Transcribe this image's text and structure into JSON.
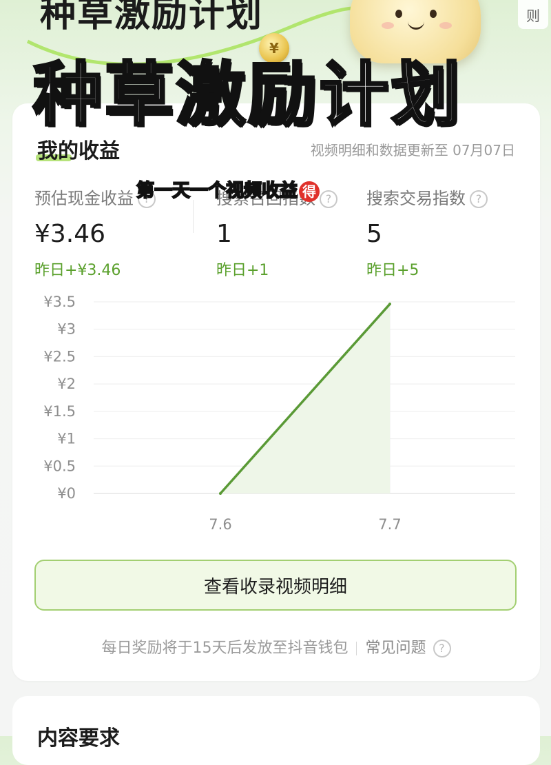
{
  "banner": {
    "title_top": "种草激励计划",
    "coin_symbol": "¥",
    "rules_tab": "则"
  },
  "overlay": {
    "title": "种草激励计划",
    "subtitle": "第一天一个视频收益",
    "subtitle_badge": "得"
  },
  "earnings": {
    "heading": "我的收益",
    "update_note": "视频明细和数据更新至 07月07日",
    "metrics": [
      {
        "label": "预估现金收益",
        "value": "¥3.46",
        "delta": "昨日+¥3.46"
      },
      {
        "label": "搜索召回指数",
        "value": "1",
        "delta": "昨日+1"
      },
      {
        "label": "搜索交易指数",
        "value": "5",
        "delta": "昨日+5"
      }
    ],
    "help_glyph": "?"
  },
  "chart_data": {
    "type": "area",
    "x": [
      "7.6",
      "7.7"
    ],
    "values": [
      0,
      3.46
    ],
    "ylim": [
      0,
      3.5
    ],
    "yticks": [
      "¥0",
      "¥0.5",
      "¥1",
      "¥1.5",
      "¥2",
      "¥2.5",
      "¥3",
      "¥3.5"
    ],
    "ytick_values": [
      0,
      0.5,
      1,
      1.5,
      2,
      2.5,
      3,
      3.5
    ],
    "grid": true,
    "line_color": "#5a9a36",
    "fill_color": "#eef6e8"
  },
  "cta": {
    "label": "查看收录视频明细"
  },
  "footnote": {
    "text": "每日奖励将于15天后发放至抖音钱包",
    "link": "常见问题"
  },
  "card2": {
    "title": "内容要求"
  },
  "colors": {
    "accent": "#5aa02c",
    "cta_border": "#a3cf72"
  }
}
